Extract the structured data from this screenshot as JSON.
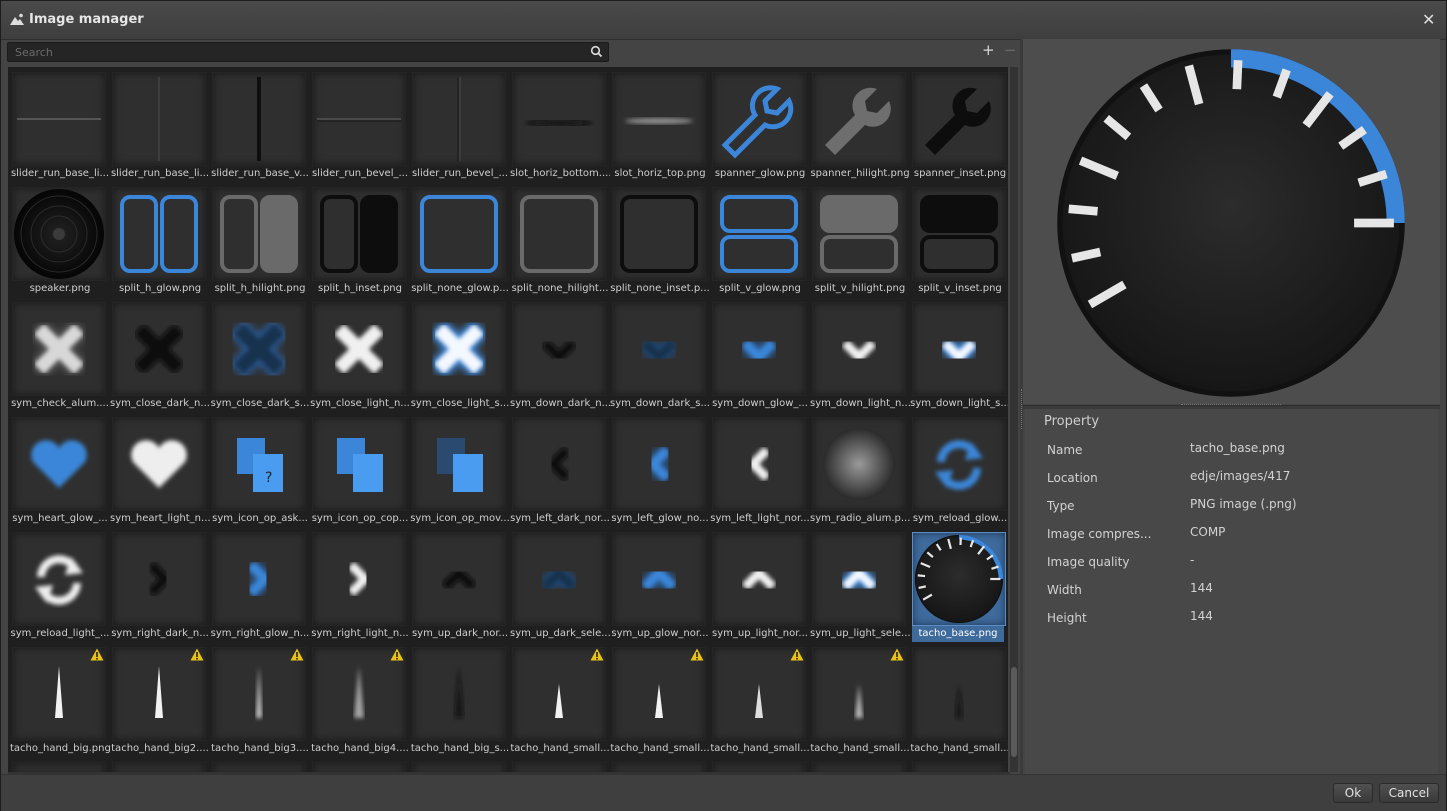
{
  "window": {
    "title": "Image manager"
  },
  "toolbar": {
    "search_placeholder": "Search",
    "add_symbol": "+",
    "remove_symbol": "−"
  },
  "grid": {
    "items": [
      {
        "label": "slider_run_base_li...",
        "art": "hline"
      },
      {
        "label": "slider_run_base_li...",
        "art": "vline-thin"
      },
      {
        "label": "slider_run_base_v...",
        "art": "vline-dark"
      },
      {
        "label": "slider_run_bevel_...",
        "art": "hline-bevel"
      },
      {
        "label": "slider_run_bevel_...",
        "art": "vline-bevel"
      },
      {
        "label": "slot_horiz_bottom....",
        "art": "slot-dark"
      },
      {
        "label": "slot_horiz_top.png",
        "art": "slot-light"
      },
      {
        "label": "spanner_glow.png",
        "art": "spanner-blue"
      },
      {
        "label": "spanner_hilight.png",
        "art": "spanner-grey"
      },
      {
        "label": "spanner_inset.png",
        "art": "spanner-black"
      },
      {
        "label": "speaker.png",
        "art": "speaker"
      },
      {
        "label": "split_h_glow.png",
        "art": "splith-blue"
      },
      {
        "label": "split_h_hilight.png",
        "art": "splith-grey"
      },
      {
        "label": "split_h_inset.png",
        "art": "splith-black"
      },
      {
        "label": "split_none_glow.p...",
        "art": "splitn-blue"
      },
      {
        "label": "split_none_hilight...",
        "art": "splitn-grey"
      },
      {
        "label": "split_none_inset.p...",
        "art": "splitn-black"
      },
      {
        "label": "split_v_glow.png",
        "art": "splitv-blue"
      },
      {
        "label": "split_v_hilight.png",
        "art": "splitv-grey"
      },
      {
        "label": "split_v_inset.png",
        "art": "splitv-black"
      },
      {
        "label": "sym_check_alum....",
        "art": "x-alum"
      },
      {
        "label": "sym_close_dark_n...",
        "art": "x-dark"
      },
      {
        "label": "sym_close_dark_s...",
        "art": "x-darkblue"
      },
      {
        "label": "sym_close_light_n...",
        "art": "x-light"
      },
      {
        "label": "sym_close_light_s...",
        "art": "x-lightblue"
      },
      {
        "label": "sym_down_dark_n...",
        "art": "down-dark"
      },
      {
        "label": "sym_down_dark_s...",
        "art": "down-darkblue"
      },
      {
        "label": "sym_down_glow_...",
        "art": "down-blue"
      },
      {
        "label": "sym_down_light_n...",
        "art": "down-light"
      },
      {
        "label": "sym_down_light_s...",
        "art": "down-lightblue"
      },
      {
        "label": "sym_heart_glow_...",
        "art": "heart-blue"
      },
      {
        "label": "sym_heart_light_n...",
        "art": "heart-light"
      },
      {
        "label": "sym_icon_op_ask...",
        "art": "doc-ask"
      },
      {
        "label": "sym_icon_op_cop...",
        "art": "doc-copy"
      },
      {
        "label": "sym_icon_op_mov...",
        "art": "doc-move"
      },
      {
        "label": "sym_left_dark_nor...",
        "art": "left-dark"
      },
      {
        "label": "sym_left_glow_no...",
        "art": "left-blue"
      },
      {
        "label": "sym_left_light_nor...",
        "art": "left-light"
      },
      {
        "label": "sym_radio_alum.p...",
        "art": "radio"
      },
      {
        "label": "sym_reload_glow...",
        "art": "reload-blue"
      },
      {
        "label": "sym_reload_light_...",
        "art": "reload-light"
      },
      {
        "label": "sym_right_dark_n...",
        "art": "right-dark"
      },
      {
        "label": "sym_right_glow_n...",
        "art": "right-blue"
      },
      {
        "label": "sym_right_light_n...",
        "art": "right-light"
      },
      {
        "label": "sym_up_dark_nor...",
        "art": "up-dark"
      },
      {
        "label": "sym_up_dark_sele...",
        "art": "up-darkblue"
      },
      {
        "label": "sym_up_glow_nor...",
        "art": "up-blue"
      },
      {
        "label": "sym_up_light_nor...",
        "art": "up-light"
      },
      {
        "label": "sym_up_light_sele...",
        "art": "up-lightblue"
      },
      {
        "label": "tacho_base.png",
        "art": "tacho",
        "selected": true
      },
      {
        "label": "tacho_hand_big.png",
        "art": "hand-solid",
        "warn": true
      },
      {
        "label": "tacho_hand_big2....",
        "art": "hand-solid",
        "warn": true
      },
      {
        "label": "tacho_hand_big3....",
        "art": "hand-soft",
        "warn": true
      },
      {
        "label": "tacho_hand_big4....",
        "art": "hand-blur",
        "warn": true
      },
      {
        "label": "tacho_hand_big_s...",
        "art": "hand-shadow"
      },
      {
        "label": "tacho_hand_small...",
        "art": "hand-small",
        "warn": true
      },
      {
        "label": "tacho_hand_small...",
        "art": "hand-small",
        "warn": true
      },
      {
        "label": "tacho_hand_small...",
        "art": "hand-small2",
        "warn": true
      },
      {
        "label": "tacho_hand_small...",
        "art": "hand-smallblur",
        "warn": true
      },
      {
        "label": "tacho_hand_small...",
        "art": "hand-smallshadow"
      }
    ]
  },
  "properties": {
    "header": "Property",
    "rows": [
      {
        "key": "Name",
        "value": "tacho_base.png"
      },
      {
        "key": "Location",
        "value": "edje/images/417"
      },
      {
        "key": "Type",
        "value": "PNG image (.png)"
      },
      {
        "key": "Image compres...",
        "value": "COMP"
      },
      {
        "key": "Image quality",
        "value": "-"
      },
      {
        "key": "Width",
        "value": "144"
      },
      {
        "key": "Height",
        "value": "144"
      }
    ]
  },
  "footer": {
    "ok_label": "Ok",
    "cancel_label": "Cancel"
  },
  "colors": {
    "accent": "#3b86d8",
    "selection": "#3e6a9c",
    "warning": "#e8c21a"
  }
}
